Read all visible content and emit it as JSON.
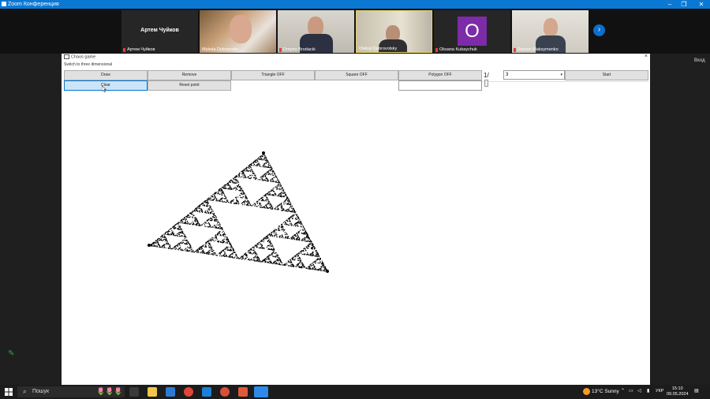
{
  "zoom": {
    "title": "Zoom Конференция",
    "window_controls": [
      "–",
      "❐",
      "✕"
    ],
    "participants": [
      {
        "name": "Артем Чуйков",
        "label": "Артем Чуйков",
        "type": "name-only"
      },
      {
        "name": "Mykola Dybovenko",
        "type": "video"
      },
      {
        "name": "Dmytro Brodacki",
        "type": "video"
      },
      {
        "name": "Oleksii Dobrovolsky",
        "type": "video"
      },
      {
        "name": "Oksana Kubaychuk",
        "type": "avatar",
        "initial": "O"
      },
      {
        "name": "Roman Maksymenko",
        "type": "video"
      }
    ],
    "enter_label": "Вход"
  },
  "app": {
    "title": "Chaos game",
    "close": "×",
    "hint": "Switch to three dimensional",
    "buttons_row1": [
      "Draw",
      "Remove",
      "Triangle OFF",
      "Square OFF",
      "Polygon OFF"
    ],
    "buttons_row2": [
      "Clear",
      "Reset point"
    ],
    "slash_label": "1/",
    "combo_value": "3",
    "start_label": "Start"
  },
  "taskbar": {
    "search_label": "Пошук",
    "weather": "13°C  Sunny",
    "lang": "УКР",
    "time": "15:10",
    "date": "09.05.2024"
  },
  "colors": {
    "zoom_blue": "#0b78d4",
    "avatar_purple": "#7d2ba8",
    "selected_button": "#cce4f7"
  }
}
